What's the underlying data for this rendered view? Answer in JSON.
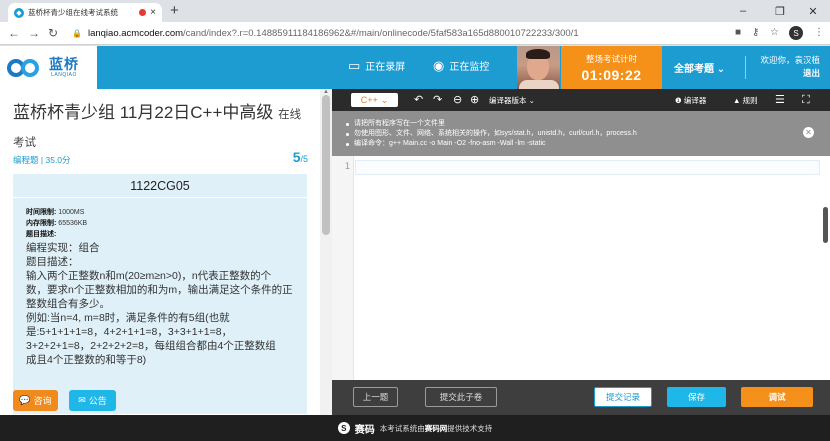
{
  "browser": {
    "tab_title": "蓝桥杯青少组在线考试系统",
    "new_tab_icon": "+",
    "url_host": "lanqiao.acmcoder.com",
    "url_path": "/cand/index?.r=0.14885911184186962&#/main/onlinecode/5faf583a165d880010722233/300/1",
    "profile_initial": "S"
  },
  "header": {
    "logo_cn": "蓝桥",
    "logo_en": "LANQIAO",
    "recording_label": "正在录屏",
    "monitoring_label": "正在监控",
    "timer_label": "整场考试计时",
    "timer_value": "01:09:22",
    "all_questions_label": "全部考题",
    "welcome_text": "欢迎你，袁汉植",
    "logout_label": "退出",
    "accent_color": "#1c9cd1",
    "timer_color": "#f59119"
  },
  "question": {
    "exam_title_main": "蓝桥杯青少组 11月22日C++中高级",
    "exam_title_suffix": "在线",
    "exam_title_tail": "考试",
    "type_label": "编程题",
    "separator": "|",
    "score": "35.0分",
    "current_number": "5",
    "total_number": "/5",
    "code": "1122CG05",
    "time_limit_label": "时间限制:",
    "time_limit": "1000MS",
    "memory_limit_label": "内存限制:",
    "memory_limit": "65536KB",
    "description_label": "题目描述:",
    "lines": [
      "编程实现：组合",
      "题目描述：",
      "输入两个正整数n和m(20≥m≥n>0)，n代表正整数的个",
      "数，要求n个正整数相加的和为m，输出满足这个条件的正",
      "整数组合有多少。",
      "例如:当n=4, m=8时，满足条件的有5组(也就",
      "是:5+1+1+1=8，4+2+1+1=8，3+3+1+1=8，",
      "3+2+2+1=8，2+2+2+2=8，每组组合都由4个正整数组",
      "成且4个正整数的和等于8)"
    ],
    "consult_label": "咨询",
    "notice_label": "公告"
  },
  "editor": {
    "language": "C++",
    "version_label": "编译器版本",
    "compiler_label": "编译器",
    "rules_label": "规则",
    "notices": [
      "请把所有程序写在一个文件里",
      "勿使用图形、文件、网络、系统相关的操作，如sys/stat.h，unistd.h，curl/curl.h，process.h",
      "编译命令：g++ Main.cc -o Main -O2 -fno-asm -Wall -lm -static"
    ],
    "line_number": "1",
    "prev_label": "上一题",
    "submit_sub_label": "提交此子卷",
    "history_label": "提交记录",
    "save_label": "保存",
    "debug_label": "调试",
    "save_color": "#1fb6e8",
    "debug_color": "#f5901a"
  },
  "footer": {
    "brand": "赛码",
    "text_pre": "本考试系统由",
    "text_brand": "赛码网",
    "text_post": "提供技术支持"
  }
}
